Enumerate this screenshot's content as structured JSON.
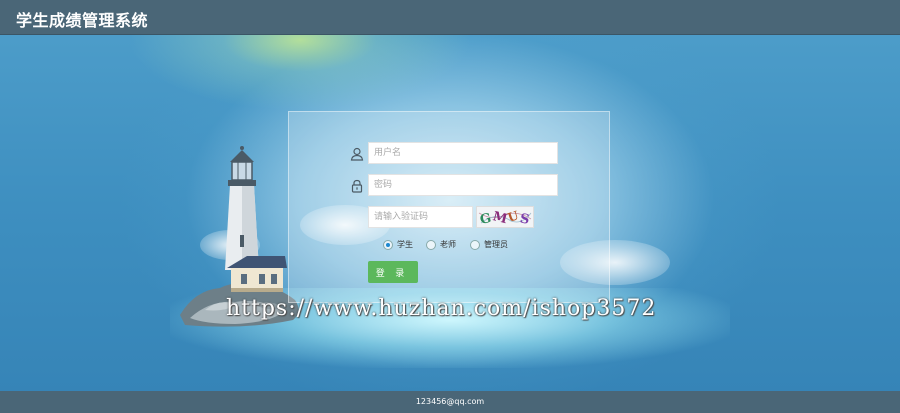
{
  "header": {
    "title": "学生成绩管理系统"
  },
  "form": {
    "username_placeholder": "用户名",
    "password_placeholder": "密码",
    "captcha_placeholder": "请输入验证码",
    "captcha_text": "GMUS",
    "roles": [
      {
        "label": "学生",
        "checked": true
      },
      {
        "label": "老师",
        "checked": false
      },
      {
        "label": "管理员",
        "checked": false
      }
    ],
    "login_label": "登 录"
  },
  "watermark": "https://www.huzhan.com/ishop3572",
  "footer": {
    "text": "123456@qq.com"
  },
  "colors": {
    "header_bg": "#4a6677",
    "login_button": "#5cb85c",
    "radio_checked": "#1e88d0"
  }
}
